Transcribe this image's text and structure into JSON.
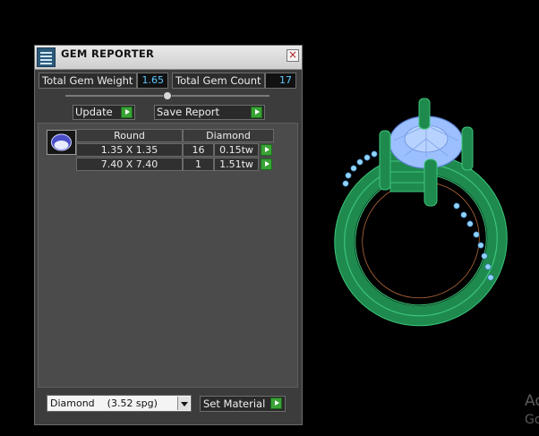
{
  "window": {
    "title": "GEM REPORTER",
    "close_glyph": "×"
  },
  "stats": {
    "weight_label": "Total Gem Weight",
    "weight_value": "1.65",
    "count_label": "Total Gem Count",
    "count_value": "17"
  },
  "slider": {
    "level": 0.5
  },
  "toolbar": {
    "update_label": "Update",
    "save_label": "Save Report"
  },
  "gem_table": {
    "headers": {
      "shape": "Round",
      "material": "Diamond"
    },
    "rows": [
      {
        "size": "1.35 X 1.35",
        "count": "16",
        "weight": "0.15tw"
      },
      {
        "size": "7.40 X 7.40",
        "count": "1",
        "weight": "1.51tw"
      }
    ]
  },
  "material": {
    "selected": "Diamond    (3.52 spg)",
    "set_label": "Set Material"
  },
  "watermark": {
    "line1": "Ac",
    "line2": "Go"
  },
  "icons": [
    "app-icon",
    "close-icon",
    "gem-thumbnail-icon",
    "arrow-right-icon",
    "dropdown-arrow-icon"
  ],
  "colors": {
    "accent_green": "#3aa336",
    "value_blue": "#5ec8ff",
    "ring_green": "#1f8a4e",
    "stone_blue": "#9cc0ff"
  }
}
